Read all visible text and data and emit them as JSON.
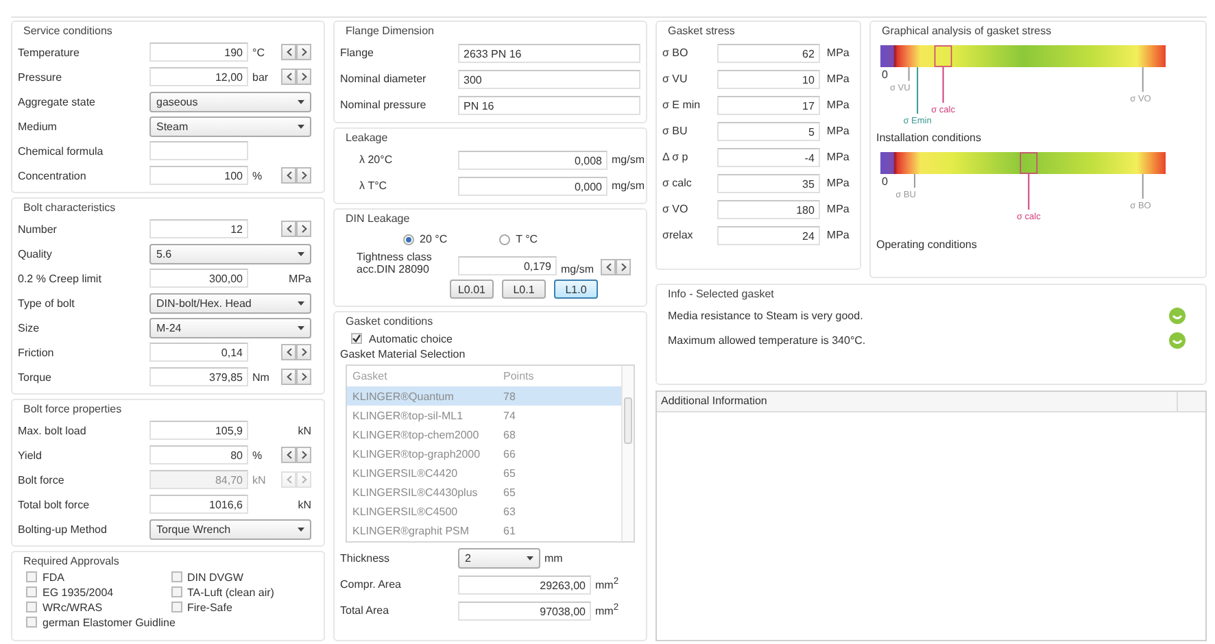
{
  "service_conditions": {
    "title": "Service conditions",
    "rows": [
      {
        "kind": "spin",
        "label": "Temperature",
        "value": "190",
        "unit": "°C",
        "disabled": false
      },
      {
        "kind": "spin",
        "label": "Pressure",
        "value": "12,00",
        "unit": "bar",
        "disabled": false
      },
      {
        "kind": "select",
        "label": "Aggregate state",
        "value": "gaseous",
        "disabled": false
      },
      {
        "kind": "select",
        "label": "Medium",
        "value": "Steam",
        "disabled": false
      },
      {
        "kind": "entry",
        "label": "Chemical formula",
        "disabled": false
      },
      {
        "kind": "spin",
        "label": "Concentration",
        "value": "100",
        "unit": "%",
        "disabled": false
      }
    ]
  },
  "bolt_characteristics": {
    "title": "Bolt characteristics",
    "rows": [
      {
        "kind": "spin",
        "label": "Number",
        "value": "12",
        "disabled": false
      },
      {
        "kind": "select",
        "label": "Quality",
        "value": "5.6",
        "disabled": false
      },
      {
        "kind": "value",
        "label": "0.2 % Creep limit",
        "value": "300,00",
        "unit": "MPa",
        "disabled": false
      },
      {
        "kind": "select",
        "label": "Type of bolt",
        "value": "DIN-bolt/Hex. Head",
        "disabled": false
      },
      {
        "kind": "select",
        "label": "Size",
        "value": "M-24",
        "disabled": false
      },
      {
        "kind": "spin",
        "label": "Friction",
        "value": "0,14",
        "disabled": false
      },
      {
        "kind": "spin",
        "label": "Torque",
        "value": "379,85",
        "unit": "Nm",
        "disabled": false
      }
    ]
  },
  "bolt_force_properties": {
    "title": "Bolt force properties",
    "rows": [
      {
        "kind": "value",
        "label": "Max. bolt load",
        "value": "105,9",
        "unit": "kN",
        "disabled": false
      },
      {
        "kind": "spin",
        "label": "Yield",
        "value": "80",
        "unit": "%",
        "disabled": false
      },
      {
        "kind": "spin",
        "label": "Bolt force",
        "value": "84,70",
        "unit": "kN",
        "disabled": true
      },
      {
        "kind": "value",
        "label": "Total bolt force",
        "value": "1016,6",
        "unit": "kN",
        "disabled": false
      },
      {
        "kind": "select",
        "label": "Bolting-up Method",
        "value": "Torque Wrench",
        "disabled": false
      }
    ]
  },
  "required_approvals": {
    "title": "Required Approvals",
    "items": [
      {
        "label": "FDA",
        "checked": false
      },
      {
        "label": "DIN DVGW",
        "checked": false
      },
      {
        "label": "EG 1935/2004",
        "checked": false
      },
      {
        "label": "TA-Luft (clean air)",
        "checked": false
      },
      {
        "label": "WRc/WRAS",
        "checked": false
      },
      {
        "label": "Fire-Safe",
        "checked": false
      },
      {
        "label": "german Elastomer Guidline",
        "checked": false
      }
    ]
  },
  "flange_dimension": {
    "title": "Flange Dimension",
    "rows": [
      {
        "label": "Flange",
        "value": "2633 PN 16"
      },
      {
        "label": "Nominal diameter",
        "value": "300"
      },
      {
        "label": "Nominal pressure",
        "value": "PN 16"
      }
    ]
  },
  "leakage": {
    "title": "Leakage",
    "rows": [
      {
        "label": "λ 20°C",
        "value": "0,008",
        "unit": "mg/sm"
      },
      {
        "label": "λ T°C",
        "value": "0,000",
        "unit": "mg/sm"
      }
    ]
  },
  "din_leakage": {
    "title": "DIN Leakage",
    "options": [
      {
        "label": "20 °C",
        "selected": true
      },
      {
        "label": "T °C",
        "selected": false
      }
    ],
    "class_label": "Tightness class",
    "standard_label": "acc.DIN 28090",
    "value": "0,179",
    "unit": "mg/sm",
    "classes": [
      {
        "label": "L0.01",
        "selected": false
      },
      {
        "label": "L0.1",
        "selected": false
      },
      {
        "label": "L1.0",
        "selected": true
      }
    ]
  },
  "gasket_conditions": {
    "title": "Gasket conditions",
    "automatic_choice": {
      "label": "Automatic choice",
      "checked": true
    },
    "selection_title": "Gasket Material Selection",
    "table": {
      "columns": [
        "Gasket",
        "Points"
      ],
      "rows": [
        {
          "gasket": "KLINGER®Quantum",
          "points": "78",
          "selected": true
        },
        {
          "gasket": "KLINGER®top-sil-ML1",
          "points": "74",
          "selected": false
        },
        {
          "gasket": "KLINGER®top-chem2000",
          "points": "68",
          "selected": false
        },
        {
          "gasket": "KLINGER®top-graph2000",
          "points": "66",
          "selected": false
        },
        {
          "gasket": "KLINGERSIL®C4420",
          "points": "65",
          "selected": false
        },
        {
          "gasket": "KLINGERSIL®C4430plus",
          "points": "65",
          "selected": false
        },
        {
          "gasket": "KLINGERSIL®C4500",
          "points": "63",
          "selected": false
        },
        {
          "gasket": "KLINGER®graphit PSM",
          "points": "61",
          "selected": false
        }
      ]
    },
    "thickness": {
      "label": "Thickness",
      "value": "2",
      "unit": "mm"
    },
    "areas": [
      {
        "label": "Compr. Area",
        "value": "29263,00",
        "unit": "mm$^{2}$"
      },
      {
        "label": "Total Area",
        "value": "97038,00",
        "unit": "mm$^{2}$"
      }
    ]
  },
  "gasket_stress": {
    "title": "Gasket stress",
    "rows": [
      {
        "label": "σ BO",
        "value": "62",
        "unit": "MPa"
      },
      {
        "label": "σ VU",
        "value": "10",
        "unit": "MPa"
      },
      {
        "label": "σ E min",
        "value": "17",
        "unit": "MPa"
      },
      {
        "label": "σ BU",
        "value": "5",
        "unit": "MPa"
      },
      {
        "label": "Δ σ p",
        "value": "-4",
        "unit": "MPa"
      },
      {
        "label": "σ calc",
        "value": "35",
        "unit": "MPa"
      },
      {
        "label": "σ VO",
        "value": "180",
        "unit": "MPa"
      },
      {
        "label": "σrelax",
        "value": "24",
        "unit": "MPa"
      }
    ]
  },
  "stress_analysis": {
    "title": "Graphical analysis of gasket stress",
    "charts": [
      {
        "caption": "Installation conditions",
        "markers": [
          {
            "kind": "zero",
            "label": "0",
            "level": 0,
            "color": "#333333",
            "highlighted": false
          },
          {
            "kind": "line",
            "label": "σ VU",
            "level": 0.1,
            "color": "#999999",
            "highlighted": false
          },
          {
            "kind": "line",
            "label": "σ Emin",
            "level": 0.13,
            "color": "#3a9a92",
            "highlighted": false
          },
          {
            "kind": "line",
            "label": "σ calc",
            "level": 0.22,
            "color": "#d0407a",
            "highlighted": true
          },
          {
            "kind": "line",
            "label": "σ VO",
            "level": 0.92,
            "color": "#999999",
            "highlighted": false
          }
        ]
      },
      {
        "caption": "Operating conditions",
        "markers": [
          {
            "kind": "zero",
            "label": "0",
            "level": 0,
            "color": "#333333",
            "highlighted": false
          },
          {
            "kind": "line",
            "label": "σ BU",
            "level": 0.12,
            "color": "#999999",
            "highlighted": false
          },
          {
            "kind": "line",
            "label": "σ calc",
            "level": 0.52,
            "color": "#d0407a",
            "highlighted": true
          },
          {
            "kind": "line",
            "label": "σ BO",
            "level": 0.92,
            "color": "#999999",
            "highlighted": false
          }
        ]
      }
    ]
  },
  "selected_gasket_info": {
    "title": "Info - Selected gasket",
    "messages": [
      {
        "kind": "ok",
        "text": "Media resistance to Steam is very good."
      },
      {
        "kind": "ok",
        "text": "Maximum allowed temperature is 340°C."
      }
    ]
  },
  "additional_information": {
    "title": "Additional Information"
  }
}
